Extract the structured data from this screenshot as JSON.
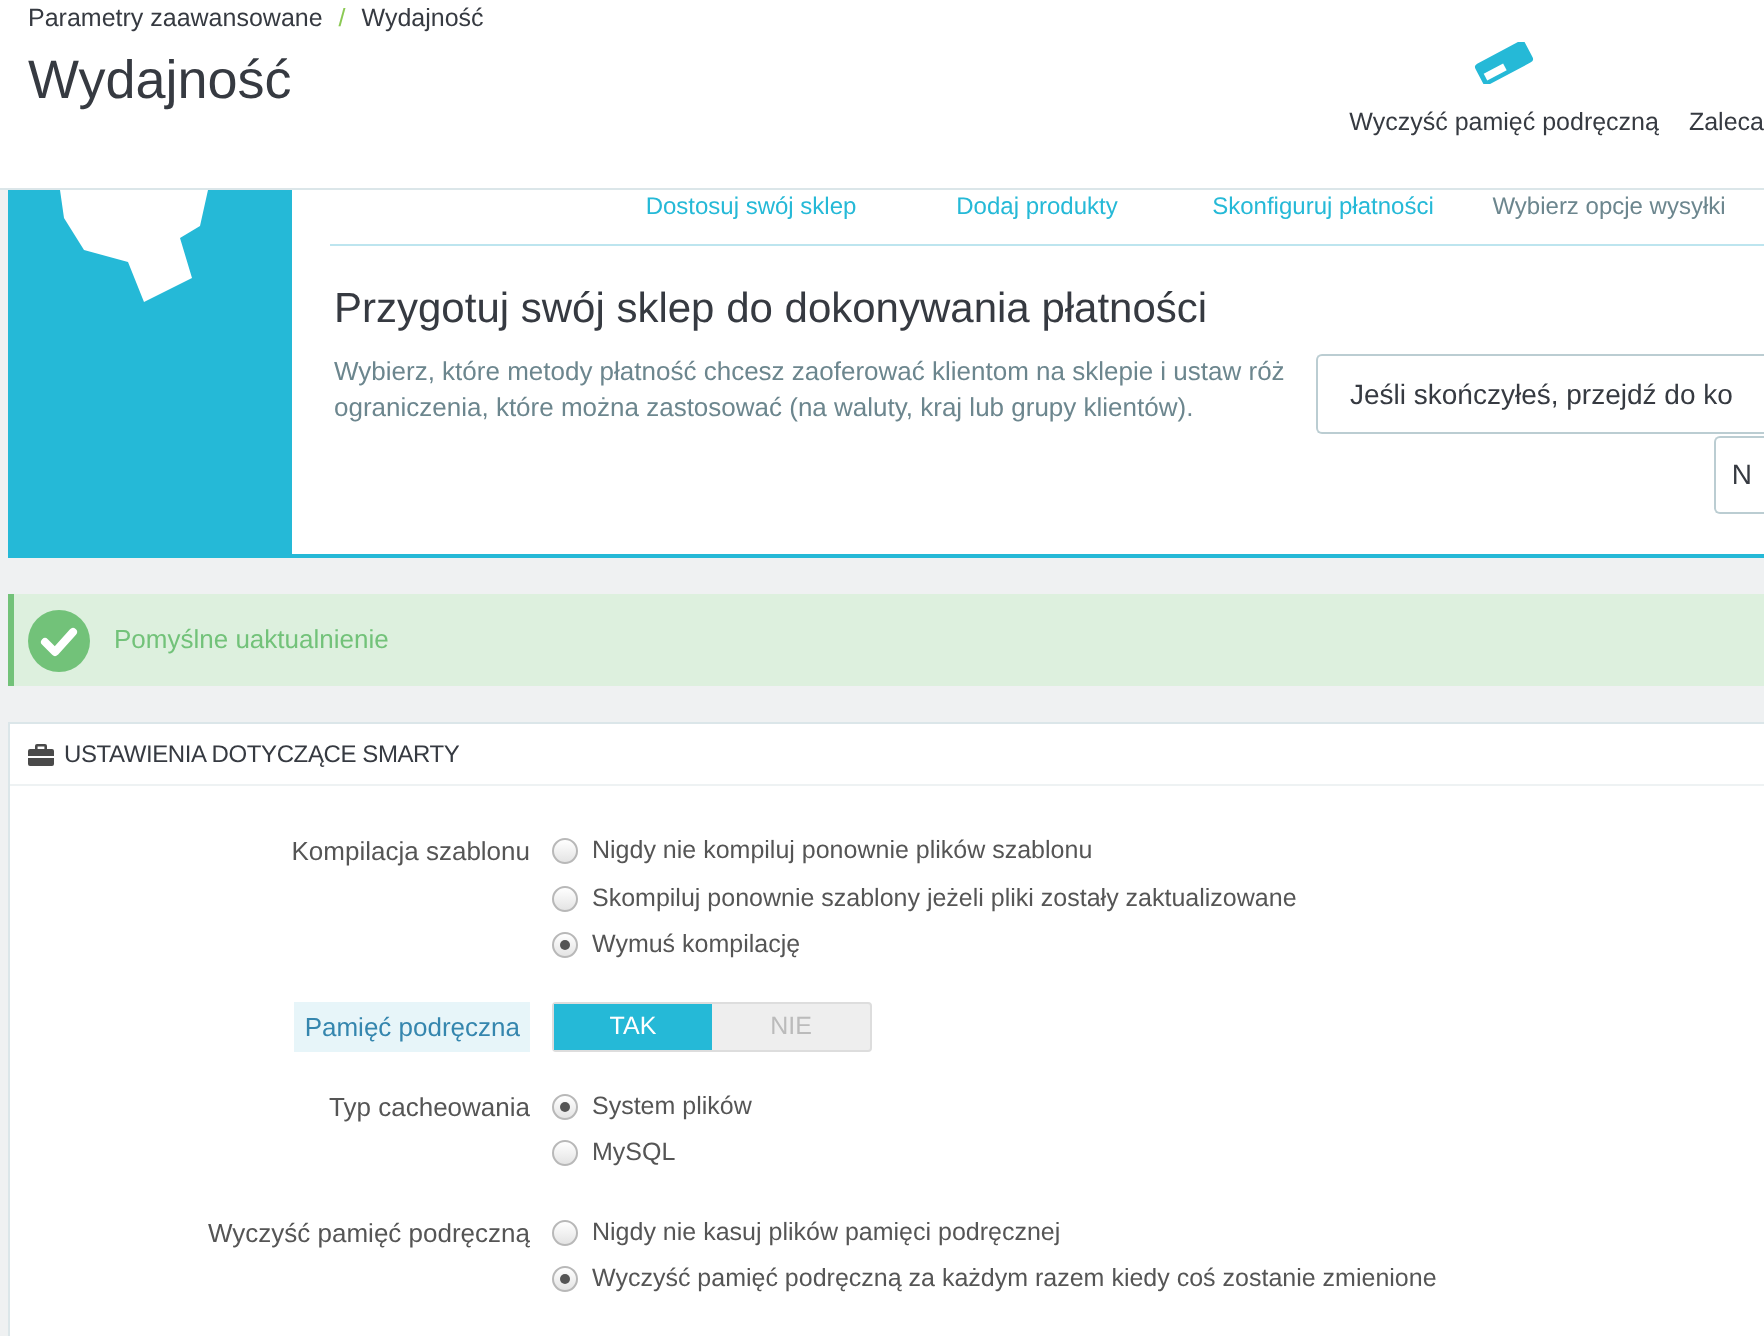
{
  "breadcrumb": {
    "items": [
      "Parametry zaawansowane",
      "Wydajność"
    ],
    "separator": "/"
  },
  "page_title": "Wydajność",
  "toolbar": [
    {
      "kind": "eraser",
      "label": "Wyczyść pamięć podręczną"
    },
    {
      "kind": "text",
      "label": "Zaleca"
    }
  ],
  "onboarding": {
    "steps": [
      {
        "label": "Dostosuj swój sklep",
        "done": true
      },
      {
        "label": "Dodaj produkty",
        "done": true
      },
      {
        "label": "Skonfiguruj płatności",
        "done": true
      },
      {
        "label": "Wybierz opcje wysyłki",
        "done": false
      }
    ],
    "heading": "Przygotuj swój sklep do dokonywania płatności",
    "description": "Wybierz, które metody płatność chcesz zaoferować klientom na sklepie i ustaw róż\nograniczenia, które można zastosować (na waluty, kraj lub grupy klientów).",
    "buttons": [
      "Jeśli skończyłeś, przejdź do ko",
      "N"
    ]
  },
  "alert": {
    "kind": "success",
    "text": "Pomyślne uaktualnienie"
  },
  "panel": {
    "title": "USTAWIENIA DOTYCZĄCE SMARTY",
    "fields": [
      {
        "label": "Kompilacja szablonu",
        "highlighted": false,
        "kind": "radio",
        "options": [
          {
            "label": "Nigdy nie kompiluj ponownie plików szablonu",
            "selected": false
          },
          {
            "label": "Skompiluj ponownie szablony jeżeli pliki zostały zaktualizowane",
            "selected": false
          },
          {
            "label": "Wymuś kompilację",
            "selected": true
          }
        ]
      },
      {
        "label": "Pamięć podręczna",
        "highlighted": true,
        "kind": "switch",
        "options": [
          {
            "label": "TAK",
            "selected": true
          },
          {
            "label": "NIE",
            "selected": false
          }
        ]
      },
      {
        "label": "Typ cacheowania",
        "highlighted": false,
        "kind": "radio",
        "options": [
          {
            "label": "System plików",
            "selected": true
          },
          {
            "label": "MySQL",
            "selected": false
          }
        ]
      },
      {
        "label": "Wyczyść pamięć podręczną",
        "highlighted": false,
        "kind": "radio",
        "options": [
          {
            "label": "Nigdy nie kasuj plików pamięci podręcznej",
            "selected": false
          },
          {
            "label": "Wyczyść pamięć podręczną za każdym razem kiedy coś zostanie zmienione",
            "selected": true
          }
        ]
      }
    ]
  }
}
